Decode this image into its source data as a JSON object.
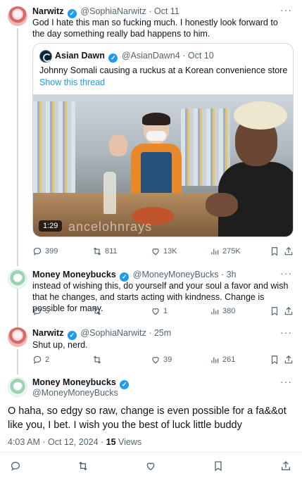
{
  "tweet1": {
    "name": "Narwitz",
    "handle": "@SophiaNarwitz",
    "date": "Oct 11",
    "text": "God I hate this man so fucking much. I honestly look forward to the day something really bad happens to him.",
    "quote": {
      "name": "Asian Dawn",
      "handle": "@AsianDawn4",
      "date": "Oct 10",
      "text": "Johnny Somali causing a ruckus at a Korean convenience store",
      "show_thread": "Show this thread",
      "video_time": "1:29",
      "watermark": "ancelohnrays"
    },
    "stats": {
      "replies": "399",
      "retweets": "811",
      "likes": "13K",
      "views": "275K"
    }
  },
  "tweet2": {
    "name": "Money Moneybucks",
    "handle": "@MoneyMoneyBucks",
    "date": "3h",
    "text": "instead of wishing this, do yourself and your soul a favor and wish that he changes, and starts acting with kindness. Change is possible for many.",
    "stats": {
      "replies": "5",
      "retweets": "",
      "likes": "1",
      "views": "380"
    }
  },
  "tweet3": {
    "name": "Narwitz",
    "handle": "@SophiaNarwitz",
    "date": "25m",
    "text": "Shut up, nerd.",
    "stats": {
      "replies": "2",
      "retweets": "",
      "likes": "39",
      "views": "261"
    }
  },
  "tweet4": {
    "name": "Money Moneybucks",
    "handle": "@MoneyMoneyBucks",
    "text": "O haha, so edgy so raw, change is even possible for a fa&&ot like you, I bet. I wish you the best of luck little buddy",
    "timestamp": "4:03 AM · Oct 12, 2024 · ",
    "views_count": "15",
    "views_label": " Views"
  },
  "sep": "·",
  "more": "···",
  "icons": [
    "reply-icon",
    "retweet-icon",
    "like-icon",
    "views-icon",
    "bookmark-icon",
    "share-icon",
    "verified-icon",
    "more-icon"
  ],
  "colors": {
    "accent": "#1d9bf0",
    "muted": "#536471",
    "text": "#0f1419"
  }
}
